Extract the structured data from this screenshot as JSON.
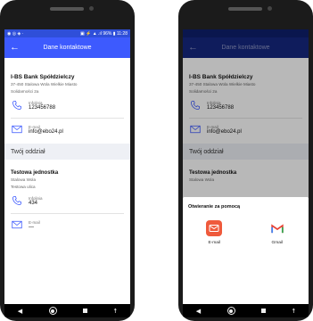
{
  "status": {
    "left": "◉ ◎ ◈ ·",
    "right": "▣ ⚡ ▲ .ıl 96% ▮ 11:28"
  },
  "appbar": {
    "title": "Dane kontaktowe",
    "back_icon": "arrow-left-icon"
  },
  "bank": {
    "name": "I-BS Bank Spółdzielczy",
    "address_line1": "37-450 Stalowa Wola Wielkie Miasto",
    "address_line2": "Solidarności 2a"
  },
  "contact": {
    "phone_label": "Infolinia",
    "phone_value": "123456788",
    "email_label": "E-mail",
    "email_value": "info@ebo24.pl"
  },
  "branch": {
    "section_title": "Twój oddział",
    "unit_name": "Testowa jednostka",
    "city": "Stalowa Wola",
    "street": "Testowa ulica",
    "phone_label": "Infolinia",
    "phone_value": "434",
    "email_label": "E-mail",
    "email_value": "—"
  },
  "sheet": {
    "title": "Otwieranie za pomocą",
    "apps": [
      {
        "label": "E-mail",
        "icon": "email-app-icon",
        "color": "#ef5a3c"
      },
      {
        "label": "Gmail",
        "icon": "gmail-icon",
        "color": "#ea4335"
      }
    ]
  },
  "colors": {
    "accent": "#3d5afe",
    "status_bar": "#2f4fd9"
  }
}
